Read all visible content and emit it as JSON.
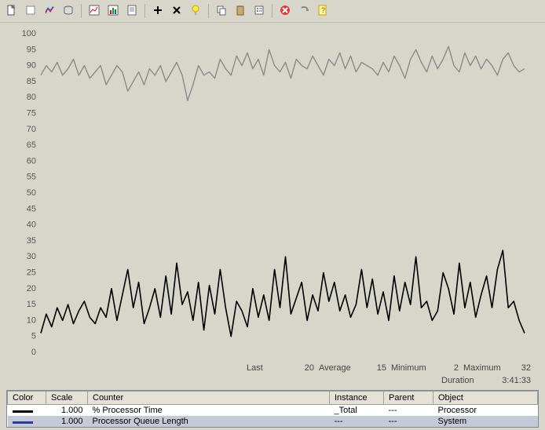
{
  "toolbar": {
    "buttons": [
      "new-counter-set",
      "clear",
      "view-current",
      "view-log",
      "sep",
      "view-chart",
      "view-histogram",
      "view-report",
      "sep",
      "add",
      "delete",
      "highlight",
      "sep",
      "copy",
      "paste",
      "properties",
      "sep",
      "freeze",
      "update",
      "help"
    ]
  },
  "chart_data": {
    "type": "line",
    "ylim": [
      0,
      100
    ],
    "yticks": [
      0,
      5,
      10,
      15,
      20,
      25,
      30,
      35,
      40,
      45,
      50,
      55,
      60,
      65,
      70,
      75,
      80,
      85,
      90,
      95,
      100
    ],
    "xcount": 90,
    "series": [
      {
        "name": "% Processor Time",
        "color": "#000000",
        "values": [
          6,
          12,
          8,
          14,
          10,
          15,
          9,
          13,
          16,
          11,
          9,
          14,
          11,
          20,
          10,
          18,
          26,
          14,
          22,
          9,
          14,
          20,
          11,
          24,
          12,
          28,
          15,
          19,
          10,
          22,
          7,
          21,
          12,
          26,
          14,
          5,
          16,
          13,
          8,
          20,
          11,
          18,
          10,
          26,
          14,
          30,
          12,
          17,
          22,
          10,
          18,
          13,
          25,
          16,
          22,
          13,
          18,
          11,
          15,
          26,
          14,
          23,
          12,
          19,
          10,
          24,
          13,
          22,
          15,
          30,
          14,
          16,
          10,
          13,
          25,
          20,
          12,
          28,
          14,
          22,
          11,
          18,
          24,
          14,
          26,
          32,
          14,
          16,
          10,
          6
        ]
      },
      {
        "name": "Processor Queue Length",
        "color": "#8a8a8a",
        "values": [
          87,
          90,
          88,
          91,
          87,
          89,
          92,
          87,
          90,
          86,
          88,
          90,
          84,
          87,
          90,
          88,
          82,
          85,
          88,
          84,
          89,
          87,
          90,
          85,
          88,
          91,
          87,
          79,
          84,
          90,
          87,
          88,
          86,
          92,
          89,
          87,
          93,
          90,
          94,
          89,
          92,
          87,
          95,
          90,
          88,
          91,
          86,
          92,
          90,
          89,
          93,
          90,
          87,
          92,
          90,
          94,
          89,
          93,
          88,
          91,
          90,
          89,
          87,
          91,
          88,
          93,
          90,
          86,
          92,
          95,
          91,
          88,
          93,
          89,
          92,
          96,
          90,
          88,
          94,
          90,
          93,
          89,
          92,
          90,
          87,
          92,
          94,
          90,
          88,
          89
        ]
      }
    ]
  },
  "stats": {
    "labels": {
      "last": "Last",
      "average": "Average",
      "minimum": "Minimum",
      "maximum": "Maximum",
      "duration": "Duration"
    },
    "last": "20",
    "average": "15",
    "minimum": "2",
    "maximum": "32",
    "duration": "3:41:33"
  },
  "table": {
    "headers": {
      "color": "Color",
      "scale": "Scale",
      "counter": "Counter",
      "instance": "Instance",
      "parent": "Parent",
      "object": "Object"
    },
    "rows": [
      {
        "color": "#000000",
        "scale": "1.000",
        "counter": "% Processor Time",
        "instance": "_Total",
        "parent": "---",
        "object": "Processor"
      },
      {
        "color": "#2b3aa0",
        "scale": "1.000",
        "counter": "Processor Queue Length",
        "instance": "---",
        "parent": "---",
        "object": "System"
      }
    ]
  }
}
